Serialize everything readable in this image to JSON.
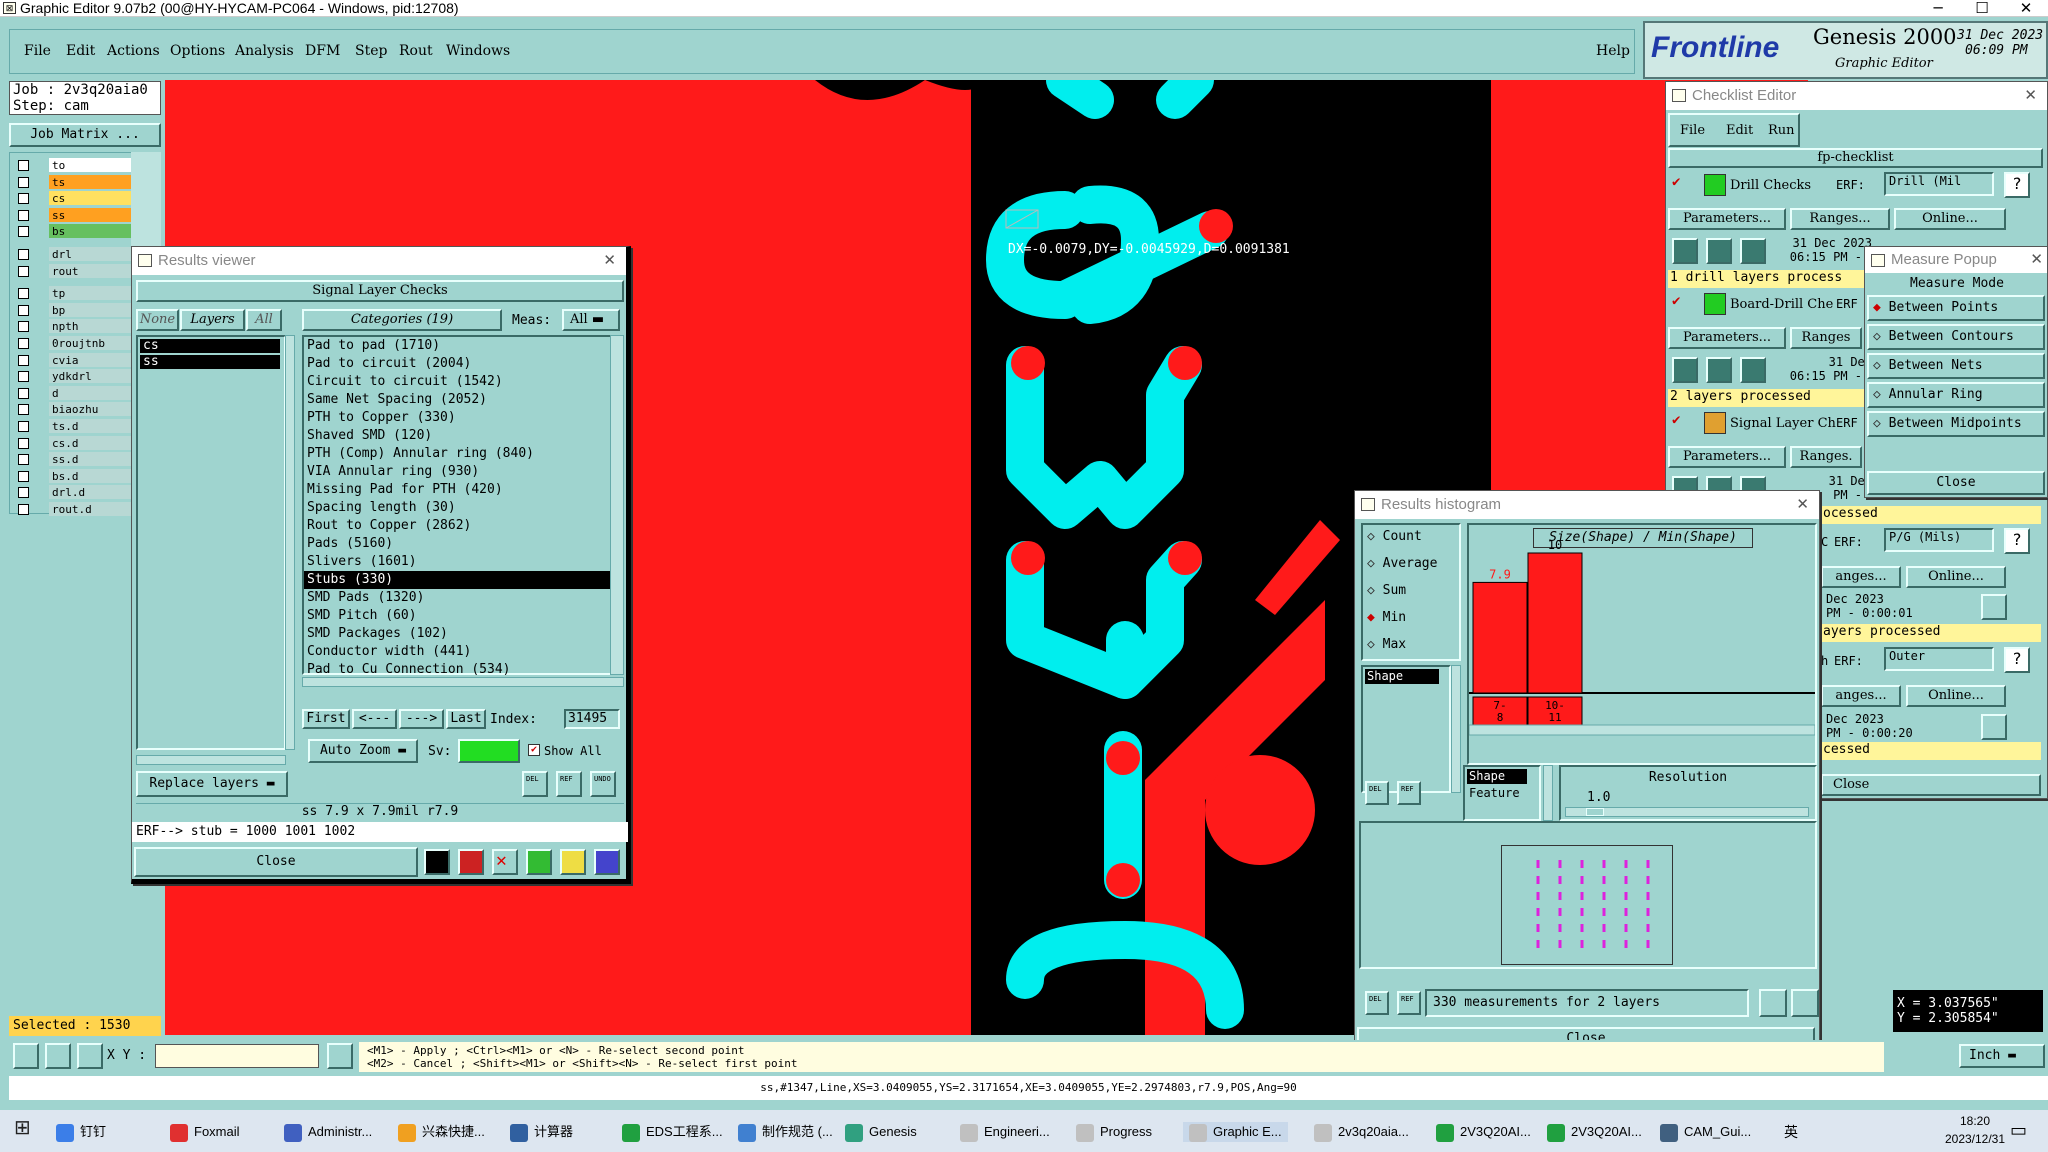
{
  "window_title": "Graphic Editor 9.07b2 (00@HY-HYCAM-PC064 - Windows, pid:12708)",
  "winctl": {
    "min": "─",
    "max": "☐",
    "close": "✕"
  },
  "menu": {
    "file": "File",
    "edit": "Edit",
    "actions": "Actions",
    "options": "Options",
    "analysis": "Analysis",
    "dfm": "DFM",
    "step": "Step",
    "rout": "Rout",
    "windows": "Windows",
    "help": "Help"
  },
  "logo": {
    "brand": "Frontline",
    "product": "Genesis 2000",
    "subtitle": "Graphic Editor",
    "date": "31 Dec 2023",
    "time": "06:09 PM"
  },
  "job": {
    "job": "Job : 2v3q20aia0",
    "step": "Step: cam",
    "matrix_btn": "Job Matrix ..."
  },
  "layers": [
    "to",
    "ts",
    "cs",
    "ss",
    "bs",
    "drl",
    "rout",
    "tp",
    "bp",
    "npth",
    "0roujtnb",
    "cvia",
    "ydkdrl",
    "d",
    "biaozhu",
    "ts.d",
    "cs.d",
    "ss.d",
    "bs.d",
    "drl.d",
    "rout.d"
  ],
  "selected_count": "Selected : 1530",
  "canvas": {
    "measure_text": "DX=-0.0079,DY=-0.0045929,D=0.0091381"
  },
  "results_viewer": {
    "title": "Results viewer",
    "header": "Signal Layer Checks",
    "filter": {
      "none": "None",
      "layers": "Layers",
      "all": "All",
      "categories": "Categories (19)",
      "meas": "Meas:",
      "meas_val": "All"
    },
    "layers": [
      "cs",
      "ss"
    ],
    "categories": [
      "Pad to pad (1710)",
      "Pad to circuit (2004)",
      "Circuit to circuit (1542)",
      "Same Net Spacing (2052)",
      "PTH to Copper (330)",
      "Shaved SMD (120)",
      "PTH (Comp) Annular ring (840)",
      "VIA Annular ring (930)",
      "Missing Pad for PTH (420)",
      "Spacing length (30)",
      "Rout to Copper (2862)",
      "Pads (5160)",
      "Slivers (1601)",
      "Stubs (330)",
      "SMD Pads (1320)",
      "SMD Pitch (60)",
      "SMD Packages (102)",
      "Conductor width (441)",
      "Pad to Cu Connection (534)"
    ],
    "selected_category": "Stubs (330)",
    "nav": {
      "first": "First",
      "prev": "<---",
      "next": "--->",
      "last": "Last",
      "index_label": "Index:",
      "index": "31495"
    },
    "auto_zoom": "Auto Zoom",
    "sv": "Sv:",
    "show_all": "Show All",
    "replace_layers": "Replace layers",
    "info": "ss 7.9 x 7.9mil  r7.9",
    "erf": "ERF--> stub = 1000 1001 1002",
    "close": "Close",
    "icons": {
      "del": "DEL",
      "ref": "REF",
      "undo": "UNDO"
    }
  },
  "histogram": {
    "title": "Results histogram",
    "options": [
      "Count",
      "Average",
      "Sum",
      "Min",
      "Max"
    ],
    "selected_option": "Min",
    "axis_title": "Size(Shape) / Min(Shape)",
    "chart_data": {
      "type": "bar",
      "title": "Size(Shape) / Min(Shape)",
      "categories": [
        "7-8",
        "10-11"
      ],
      "values": [
        7.9,
        10
      ],
      "ylim": [
        0,
        10
      ]
    },
    "bin1_label": [
      "7-",
      "8"
    ],
    "bin2_label": [
      "10-",
      "11"
    ],
    "shape_list": [
      "Shape"
    ],
    "shape_list2": [
      "Shape",
      "Feature"
    ],
    "resolution_label": "Resolution",
    "resolution": "1.0",
    "status": "330 measurements for 2 layers",
    "close": "Close",
    "icons": {
      "del": "DEL",
      "ref": "REF"
    }
  },
  "checklist": {
    "title": "Checklist Editor",
    "menu": {
      "file": "File",
      "edit": "Edit",
      "run": "Run"
    },
    "name": "fp-checklist",
    "items": [
      {
        "name": "Drill Checks",
        "erf": "ERF:",
        "erf_val": "Drill (Mil",
        "params": "Parameters...",
        "ranges": "Ranges...",
        "online": "Online...",
        "date1": "31 Dec 2023",
        "date2": "06:15 PM - ",
        "status": "1 drill layers process"
      },
      {
        "name": "Board-Drill Che",
        "erf": "ERF",
        "params": "Parameters...",
        "ranges": "Ranges",
        "date1": "31 Dec",
        "date2": "06:15 PM -",
        "status": "2 layers processed"
      },
      {
        "name": "Signal Layer Ch",
        "erf": "ERF",
        "params": "Parameters...",
        "ranges": "Ranges.",
        "date1": "31 Dec",
        "date2": "PM - "
      }
    ],
    "right": {
      "row_processed": "ocessed",
      "erf1": "ERF:",
      "erf1_val": "P/G (Mils)",
      "ranges1": "anges...",
      "online1": "Online...",
      "date_a": "Dec 2023",
      "time_a": "PM - 0:00:01",
      "proc_a": "ayers processed",
      "erf2": "ERF:",
      "erf2_val": "Outer",
      "ranges2": "anges...",
      "online2": "Online...",
      "date_b": "Dec 2023",
      "time_b": "PM - 0:00:20",
      "proc_b": "cessed",
      "close": "Close",
      "c": "C",
      "h": "h"
    }
  },
  "measure_popup": {
    "title": "Measure Popup",
    "mode": "Measure Mode",
    "options": [
      "Between Points",
      "Between Contours",
      "Between Nets",
      "Annular Ring",
      "Between Midpoints"
    ],
    "selected": "Between Points",
    "close": "Close"
  },
  "coords": {
    "x": "X = 3.037565\"",
    "y": "Y = 2.305854\""
  },
  "bottom": {
    "xy": "X Y :",
    "hint1": "<M1> - Apply  ; <Ctrl><M1> or <N> - Re-select second point",
    "hint2": "<M2> - Cancel ; <Shift><M1> or <Shift><N> - Re-select first point",
    "units": "Inch",
    "status": "ss,#1347,Line,XS=3.0409055,YS=2.3171654,XE=3.0409055,YE=2.2974803,r7.9,POS,Ang=90"
  },
  "taskbar": {
    "items": [
      "钉钉",
      "Foxmail",
      "Administr...",
      "兴森快捷...",
      "计算器",
      "EDS工程系...",
      "制作规范 (...",
      "Genesis",
      "Engineeri...",
      "Progress",
      "Graphic E...",
      "2v3q20aia...",
      "2V3Q20AI...",
      "2V3Q20AI...",
      "CAM_Gui..."
    ],
    "time": "18:20",
    "date": "2023/12/31",
    "lang": "英"
  },
  "colors": {
    "copper": "#ff1a1a",
    "silk": "#00eeee",
    "bg": "#000000",
    "panel": "#9fd4cf"
  }
}
